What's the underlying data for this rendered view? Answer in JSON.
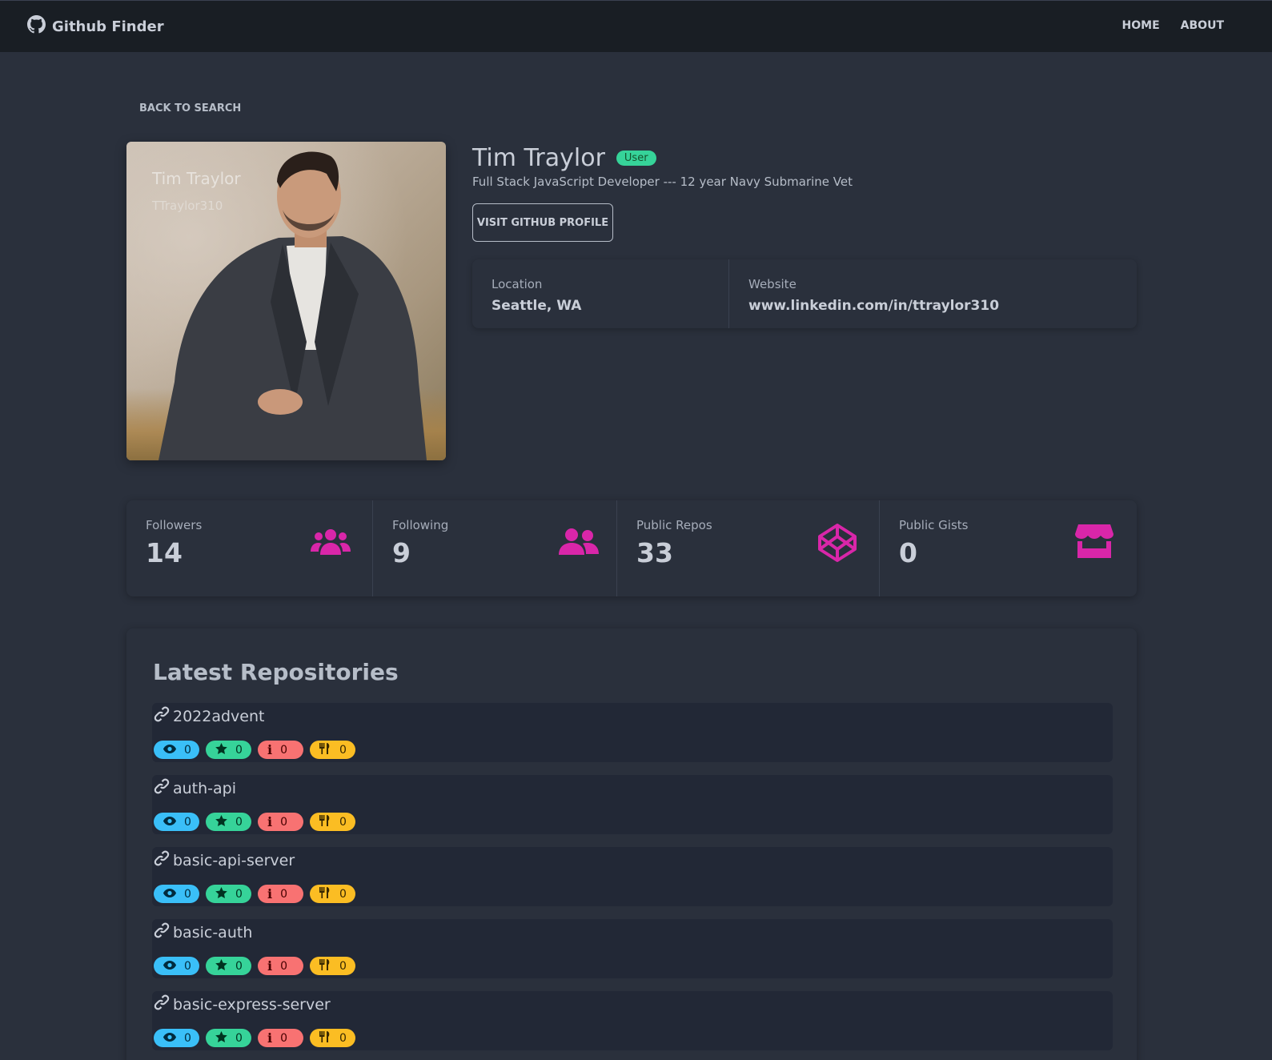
{
  "navbar": {
    "brand": "Github Finder",
    "links": [
      "HOME",
      "ABOUT"
    ]
  },
  "back_link": "BACK TO SEARCH",
  "profile": {
    "photo_overlay_name": "Tim Traylor",
    "photo_overlay_login": "TTraylor310",
    "name": "Tim Traylor",
    "type_badge": "User",
    "bio": "Full Stack JavaScript Developer --- 12 year Navy Submarine Vet",
    "visit_button": "VISIT GITHUB PROFILE",
    "location_label": "Location",
    "location_value": "Seattle, WA",
    "website_label": "Website",
    "website_value": "www.linkedin.com/in/ttraylor310"
  },
  "stats": [
    {
      "label": "Followers",
      "value": "14",
      "icon": "users-icon"
    },
    {
      "label": "Following",
      "value": "9",
      "icon": "user-friends-icon"
    },
    {
      "label": "Public Repos",
      "value": "33",
      "icon": "codepen-icon"
    },
    {
      "label": "Public Gists",
      "value": "0",
      "icon": "store-icon"
    }
  ],
  "repos_title": "Latest Repositories",
  "repos": [
    {
      "name": "2022advent",
      "watchers": "0",
      "stars": "0",
      "issues": "0",
      "forks": "0"
    },
    {
      "name": "auth-api",
      "watchers": "0",
      "stars": "0",
      "issues": "0",
      "forks": "0"
    },
    {
      "name": "basic-api-server",
      "watchers": "0",
      "stars": "0",
      "issues": "0",
      "forks": "0"
    },
    {
      "name": "basic-auth",
      "watchers": "0",
      "stars": "0",
      "issues": "0",
      "forks": "0"
    },
    {
      "name": "basic-express-server",
      "watchers": "0",
      "stars": "0",
      "issues": "0",
      "forks": "0"
    }
  ],
  "colors": {
    "accent_icon": "#d926a9",
    "info": "#3abff8",
    "success": "#36d399",
    "error": "#f87272",
    "warning": "#fbbd23"
  }
}
